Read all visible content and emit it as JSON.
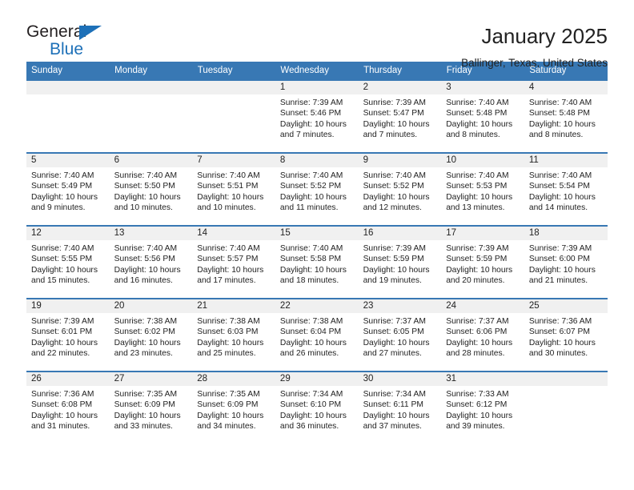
{
  "brand": {
    "name_dark": "General",
    "name_blue": "Blue",
    "accent_color": "#1d70b8"
  },
  "header": {
    "title": "January 2025",
    "subtitle": "Ballinger, Texas, United States"
  },
  "theme": {
    "header_bg": "#3878b4",
    "daynum_bg": "#f0f0f0",
    "text": "#222222"
  },
  "calendar": {
    "weekday_headers": [
      "Sunday",
      "Monday",
      "Tuesday",
      "Wednesday",
      "Thursday",
      "Friday",
      "Saturday"
    ],
    "labels": {
      "sunrise": "Sunrise:",
      "sunset": "Sunset:",
      "daylight": "Daylight:"
    },
    "weeks": [
      [
        {
          "day": "",
          "empty": true
        },
        {
          "day": "",
          "empty": true
        },
        {
          "day": "",
          "empty": true
        },
        {
          "day": "1",
          "line1": "Sunrise: 7:39 AM",
          "line2": "Sunset: 5:46 PM",
          "line3": "Daylight: 10 hours",
          "line4": "and 7 minutes."
        },
        {
          "day": "2",
          "line1": "Sunrise: 7:39 AM",
          "line2": "Sunset: 5:47 PM",
          "line3": "Daylight: 10 hours",
          "line4": "and 7 minutes."
        },
        {
          "day": "3",
          "line1": "Sunrise: 7:40 AM",
          "line2": "Sunset: 5:48 PM",
          "line3": "Daylight: 10 hours",
          "line4": "and 8 minutes."
        },
        {
          "day": "4",
          "line1": "Sunrise: 7:40 AM",
          "line2": "Sunset: 5:48 PM",
          "line3": "Daylight: 10 hours",
          "line4": "and 8 minutes."
        }
      ],
      [
        {
          "day": "5",
          "line1": "Sunrise: 7:40 AM",
          "line2": "Sunset: 5:49 PM",
          "line3": "Daylight: 10 hours",
          "line4": "and 9 minutes."
        },
        {
          "day": "6",
          "line1": "Sunrise: 7:40 AM",
          "line2": "Sunset: 5:50 PM",
          "line3": "Daylight: 10 hours",
          "line4": "and 10 minutes."
        },
        {
          "day": "7",
          "line1": "Sunrise: 7:40 AM",
          "line2": "Sunset: 5:51 PM",
          "line3": "Daylight: 10 hours",
          "line4": "and 10 minutes."
        },
        {
          "day": "8",
          "line1": "Sunrise: 7:40 AM",
          "line2": "Sunset: 5:52 PM",
          "line3": "Daylight: 10 hours",
          "line4": "and 11 minutes."
        },
        {
          "day": "9",
          "line1": "Sunrise: 7:40 AM",
          "line2": "Sunset: 5:52 PM",
          "line3": "Daylight: 10 hours",
          "line4": "and 12 minutes."
        },
        {
          "day": "10",
          "line1": "Sunrise: 7:40 AM",
          "line2": "Sunset: 5:53 PM",
          "line3": "Daylight: 10 hours",
          "line4": "and 13 minutes."
        },
        {
          "day": "11",
          "line1": "Sunrise: 7:40 AM",
          "line2": "Sunset: 5:54 PM",
          "line3": "Daylight: 10 hours",
          "line4": "and 14 minutes."
        }
      ],
      [
        {
          "day": "12",
          "line1": "Sunrise: 7:40 AM",
          "line2": "Sunset: 5:55 PM",
          "line3": "Daylight: 10 hours",
          "line4": "and 15 minutes."
        },
        {
          "day": "13",
          "line1": "Sunrise: 7:40 AM",
          "line2": "Sunset: 5:56 PM",
          "line3": "Daylight: 10 hours",
          "line4": "and 16 minutes."
        },
        {
          "day": "14",
          "line1": "Sunrise: 7:40 AM",
          "line2": "Sunset: 5:57 PM",
          "line3": "Daylight: 10 hours",
          "line4": "and 17 minutes."
        },
        {
          "day": "15",
          "line1": "Sunrise: 7:40 AM",
          "line2": "Sunset: 5:58 PM",
          "line3": "Daylight: 10 hours",
          "line4": "and 18 minutes."
        },
        {
          "day": "16",
          "line1": "Sunrise: 7:39 AM",
          "line2": "Sunset: 5:59 PM",
          "line3": "Daylight: 10 hours",
          "line4": "and 19 minutes."
        },
        {
          "day": "17",
          "line1": "Sunrise: 7:39 AM",
          "line2": "Sunset: 5:59 PM",
          "line3": "Daylight: 10 hours",
          "line4": "and 20 minutes."
        },
        {
          "day": "18",
          "line1": "Sunrise: 7:39 AM",
          "line2": "Sunset: 6:00 PM",
          "line3": "Daylight: 10 hours",
          "line4": "and 21 minutes."
        }
      ],
      [
        {
          "day": "19",
          "line1": "Sunrise: 7:39 AM",
          "line2": "Sunset: 6:01 PM",
          "line3": "Daylight: 10 hours",
          "line4": "and 22 minutes."
        },
        {
          "day": "20",
          "line1": "Sunrise: 7:38 AM",
          "line2": "Sunset: 6:02 PM",
          "line3": "Daylight: 10 hours",
          "line4": "and 23 minutes."
        },
        {
          "day": "21",
          "line1": "Sunrise: 7:38 AM",
          "line2": "Sunset: 6:03 PM",
          "line3": "Daylight: 10 hours",
          "line4": "and 25 minutes."
        },
        {
          "day": "22",
          "line1": "Sunrise: 7:38 AM",
          "line2": "Sunset: 6:04 PM",
          "line3": "Daylight: 10 hours",
          "line4": "and 26 minutes."
        },
        {
          "day": "23",
          "line1": "Sunrise: 7:37 AM",
          "line2": "Sunset: 6:05 PM",
          "line3": "Daylight: 10 hours",
          "line4": "and 27 minutes."
        },
        {
          "day": "24",
          "line1": "Sunrise: 7:37 AM",
          "line2": "Sunset: 6:06 PM",
          "line3": "Daylight: 10 hours",
          "line4": "and 28 minutes."
        },
        {
          "day": "25",
          "line1": "Sunrise: 7:36 AM",
          "line2": "Sunset: 6:07 PM",
          "line3": "Daylight: 10 hours",
          "line4": "and 30 minutes."
        }
      ],
      [
        {
          "day": "26",
          "line1": "Sunrise: 7:36 AM",
          "line2": "Sunset: 6:08 PM",
          "line3": "Daylight: 10 hours",
          "line4": "and 31 minutes."
        },
        {
          "day": "27",
          "line1": "Sunrise: 7:35 AM",
          "line2": "Sunset: 6:09 PM",
          "line3": "Daylight: 10 hours",
          "line4": "and 33 minutes."
        },
        {
          "day": "28",
          "line1": "Sunrise: 7:35 AM",
          "line2": "Sunset: 6:09 PM",
          "line3": "Daylight: 10 hours",
          "line4": "and 34 minutes."
        },
        {
          "day": "29",
          "line1": "Sunrise: 7:34 AM",
          "line2": "Sunset: 6:10 PM",
          "line3": "Daylight: 10 hours",
          "line4": "and 36 minutes."
        },
        {
          "day": "30",
          "line1": "Sunrise: 7:34 AM",
          "line2": "Sunset: 6:11 PM",
          "line3": "Daylight: 10 hours",
          "line4": "and 37 minutes."
        },
        {
          "day": "31",
          "line1": "Sunrise: 7:33 AM",
          "line2": "Sunset: 6:12 PM",
          "line3": "Daylight: 10 hours",
          "line4": "and 39 minutes."
        },
        {
          "day": "",
          "empty": true
        }
      ]
    ]
  }
}
